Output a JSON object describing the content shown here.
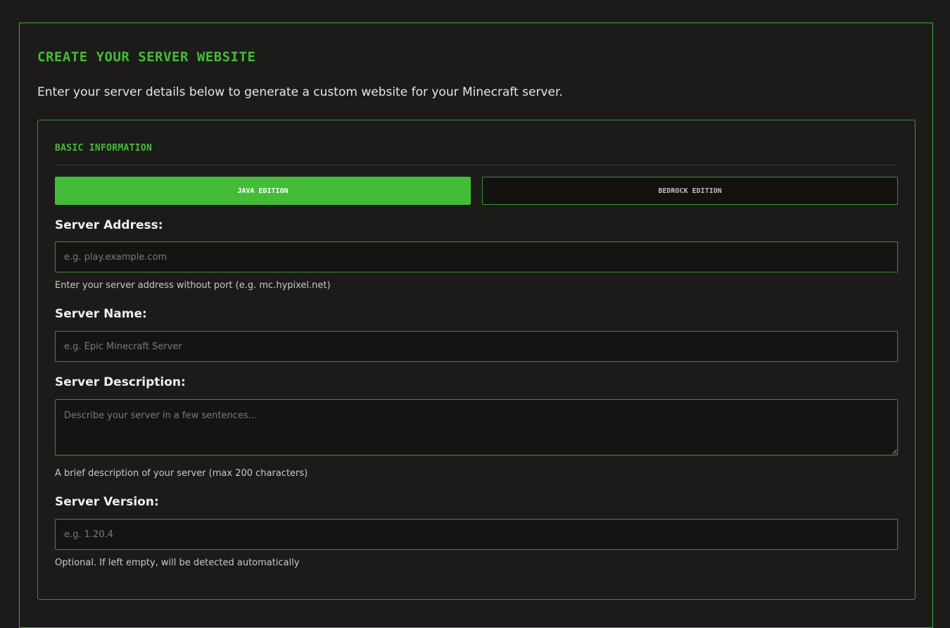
{
  "page": {
    "title": "CREATE YOUR SERVER WEBSITE",
    "intro": "Enter your server details below to generate a custom website for your Minecraft server."
  },
  "section": {
    "title": "BASIC INFORMATION"
  },
  "editions": {
    "java_label": "JAVA EDITION",
    "bedrock_label": "BEDROCK EDITION",
    "selected": "JAVA EDITION"
  },
  "fields": {
    "address": {
      "label": "Server Address:",
      "placeholder": "e.g. play.example.com",
      "value": "",
      "hint": "Enter your server address without port (e.g. mc.hypixel.net)"
    },
    "name": {
      "label": "Server Name:",
      "placeholder": "e.g. Epic Minecraft Server",
      "value": ""
    },
    "description": {
      "label": "Server Description:",
      "placeholder": "Describe your server in a few sentences...",
      "value": "",
      "hint": "A brief description of your server (max 200 characters)"
    },
    "version": {
      "label": "Server Version:",
      "placeholder": "e.g. 1.20.4",
      "value": "",
      "hint": "Optional. If left empty, will be detected automatically"
    }
  },
  "colors": {
    "accent": "#43bd37",
    "border": "#3a8f33",
    "background": "#1c1b1a",
    "input_background": "#141413"
  }
}
